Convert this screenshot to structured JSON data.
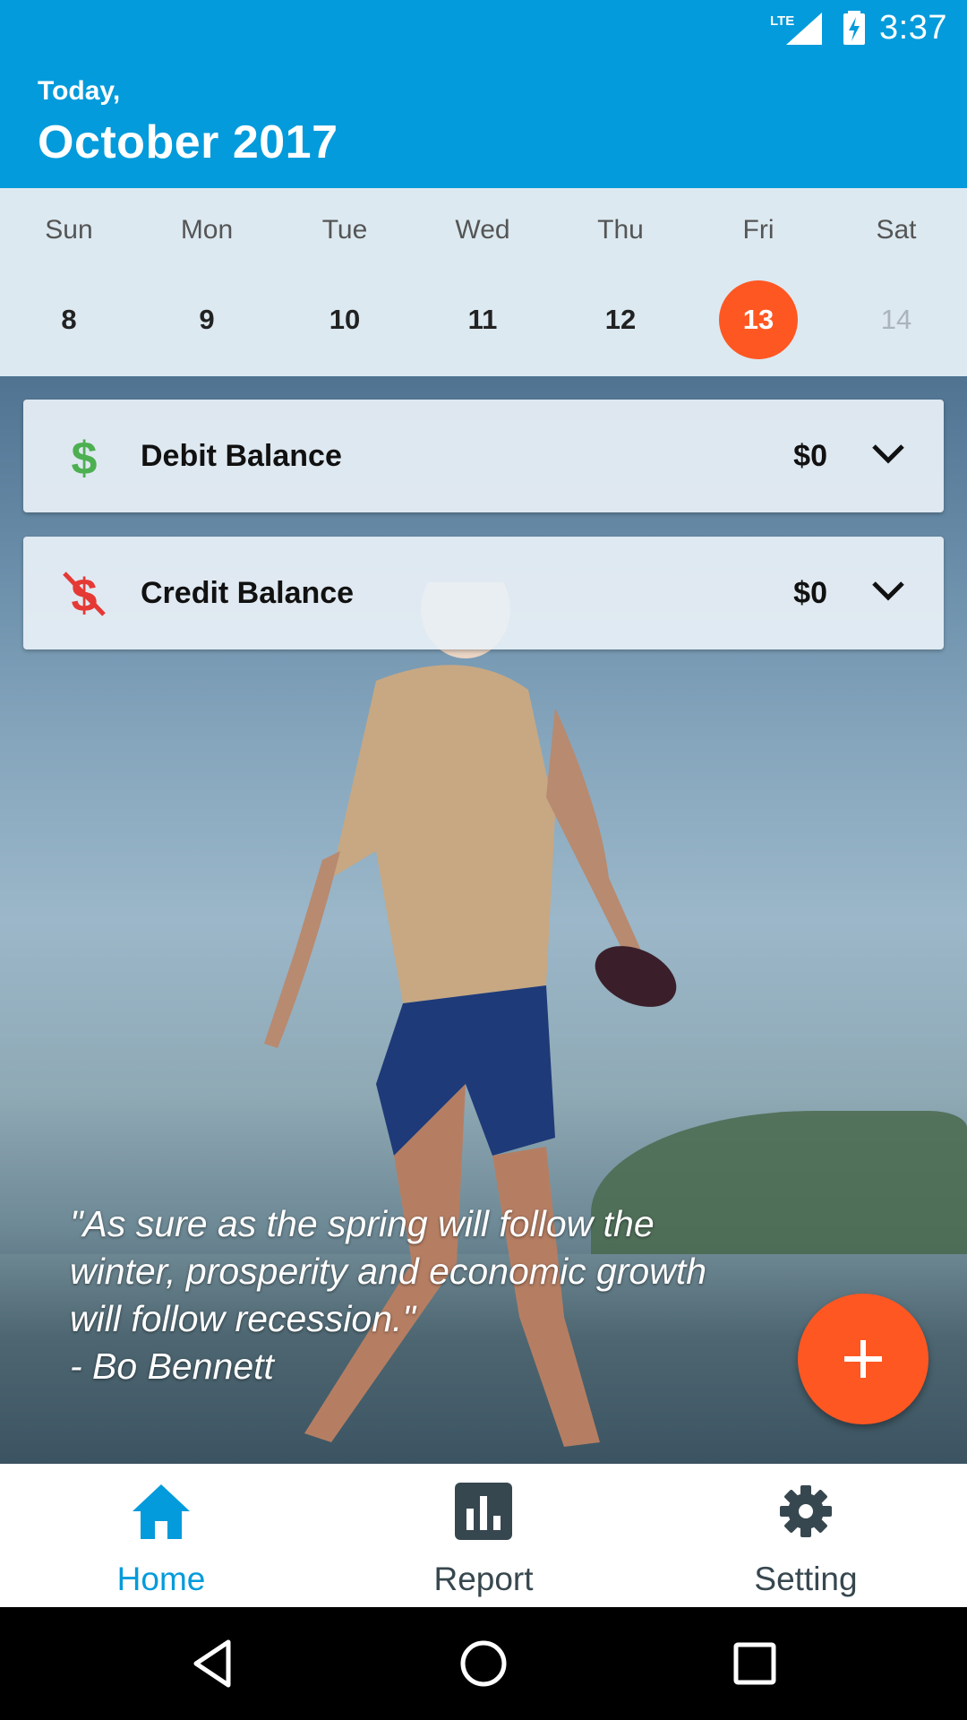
{
  "status_bar": {
    "time": "3:37",
    "network": "LTE"
  },
  "header": {
    "subtitle": "Today,",
    "title": "October 2017"
  },
  "week": {
    "days": [
      {
        "name": "Sun",
        "num": "8"
      },
      {
        "name": "Mon",
        "num": "9"
      },
      {
        "name": "Tue",
        "num": "10"
      },
      {
        "name": "Wed",
        "num": "11"
      },
      {
        "name": "Thu",
        "num": "12"
      },
      {
        "name": "Fri",
        "num": "13"
      },
      {
        "name": "Sat",
        "num": "14"
      }
    ],
    "selected_index": 5
  },
  "balances": {
    "debit": {
      "label": "Debit Balance",
      "amount": "$0",
      "icon": "dollar-icon",
      "color": "#4CAF50"
    },
    "credit": {
      "label": "Credit Balance",
      "amount": "$0",
      "icon": "dollar-off-icon",
      "color": "#E53935"
    }
  },
  "quote": {
    "text": "\"As sure as the spring will follow the\nwinter, prosperity and economic growth\nwill follow recession.\"\n- Bo Bennett"
  },
  "fab": {
    "icon": "plus-icon",
    "color": "#FF5722"
  },
  "bottom_nav": {
    "items": [
      {
        "label": "Home",
        "icon": "home-icon",
        "active": true
      },
      {
        "label": "Report",
        "icon": "bar-chart-icon",
        "active": false
      },
      {
        "label": "Setting",
        "icon": "gear-icon",
        "active": false
      }
    ]
  },
  "colors": {
    "primary": "#039BDB",
    "accent": "#FF5722",
    "week_bg": "#DCE9F1"
  }
}
